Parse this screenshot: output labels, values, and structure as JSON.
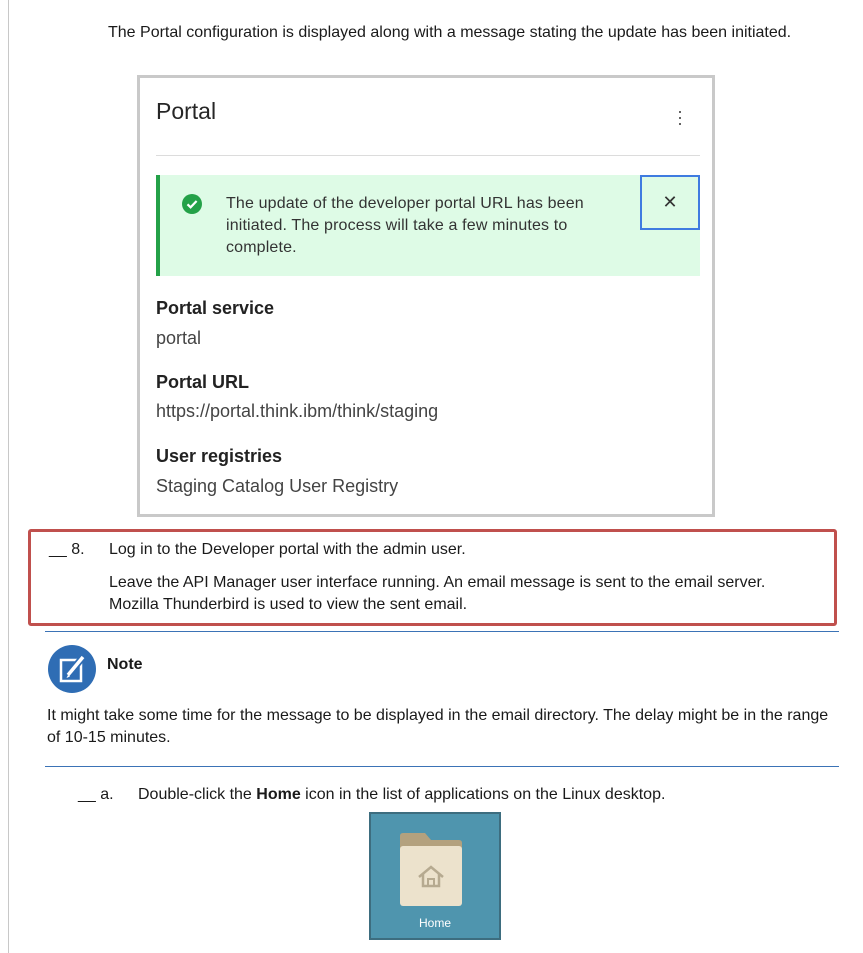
{
  "intro": "The Portal configuration is displayed along with a message stating the update has been initiated.",
  "portal": {
    "title": "Portal",
    "notification": "The update of the developer portal URL has been initiated. The process will take a few minutes to complete.",
    "close_symbol": "✕",
    "fields": [
      {
        "label": "Portal service",
        "value": "portal"
      },
      {
        "label": "Portal URL",
        "value": "https://portal.think.ibm/think/staging"
      },
      {
        "label": "User registries",
        "value": "Staging Catalog User Registry"
      }
    ]
  },
  "step": {
    "number": "__ 8.",
    "instruction": "Log in to the Developer portal with the admin user.",
    "detail": "Leave the API Manager user interface running. An email message is sent to the email server. Mozilla Thunderbird is used to view the sent email."
  },
  "note": {
    "title": "Note",
    "body": "It might take some time for the message to be displayed in the email directory. The delay might be in the range of 10-15 minutes."
  },
  "substep": {
    "number": "__ a.",
    "text_before": "Double-click the ",
    "bold": "Home",
    "text_after": " icon in the list of applications on the Linux desktop."
  },
  "desktop_icon": {
    "label": "Home"
  },
  "colors": {
    "success": "#24a148",
    "notification_bg": "#defbe6",
    "highlight_border": "#c0504d",
    "rule": "#3b73b6",
    "focus": "#3f7be0"
  }
}
